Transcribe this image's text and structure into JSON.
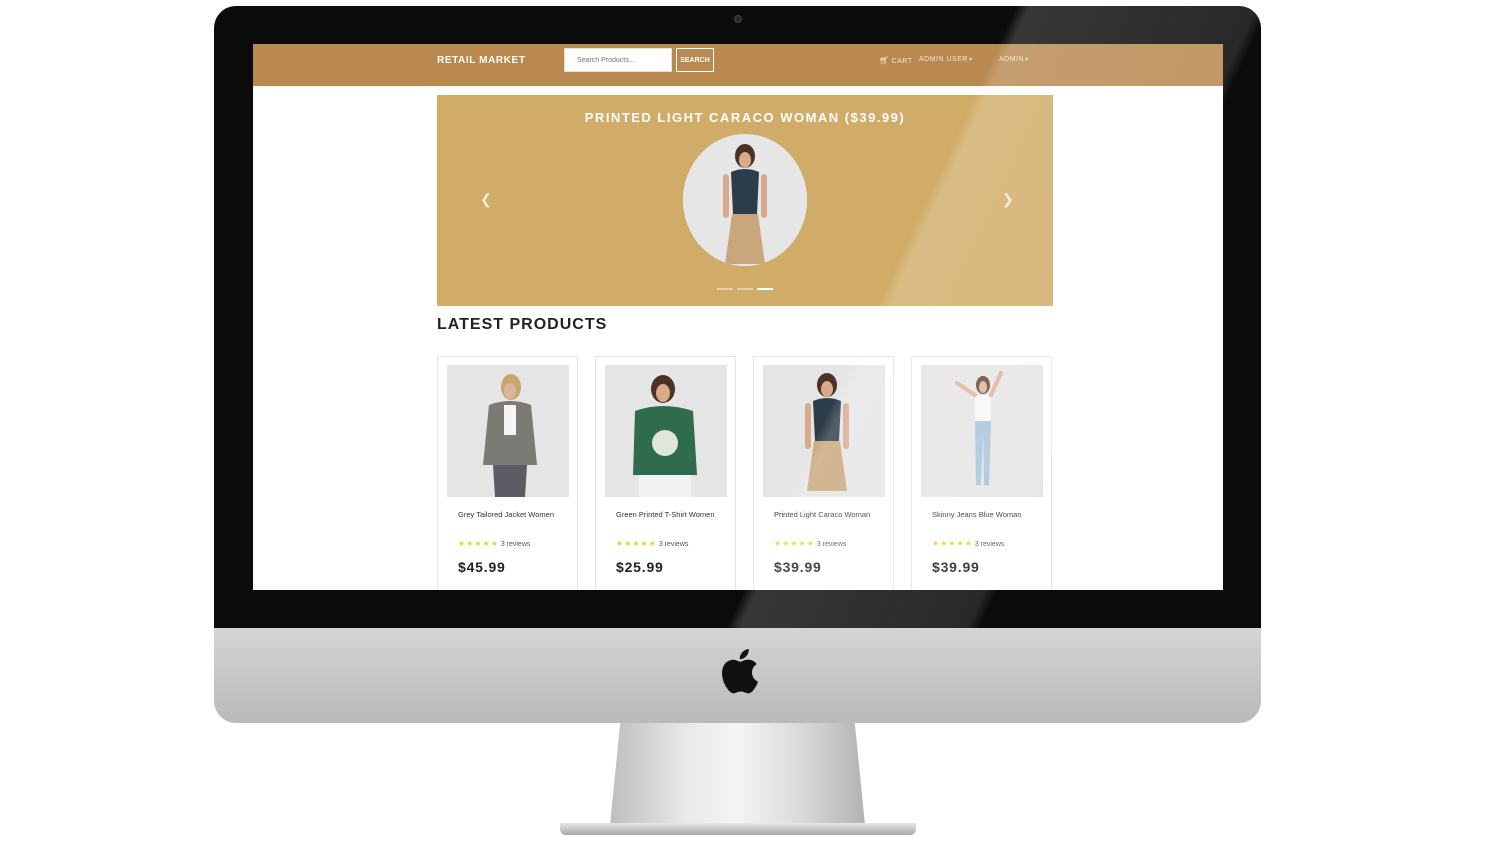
{
  "navbar": {
    "brand": "RETAIL MARKET",
    "search_placeholder": "Search Products...",
    "search_button": "SEARCH",
    "cart_label": "CART",
    "admin_user_label": "ADMIN USER",
    "admin_label": "ADMIN"
  },
  "banner": {
    "title": "PRINTED LIGHT CARACO WOMAN ($39.99)",
    "prev_icon": "chevron-left-icon",
    "next_icon": "chevron-right-icon",
    "slide_count": 3,
    "active_slide": 3
  },
  "latest": {
    "title": "LATEST PRODUCTS",
    "products": [
      {
        "name": "Grey Tailored Jacket Women",
        "rating": 5,
        "reviews": "3 reviews",
        "price": "$45.99"
      },
      {
        "name": "Green Printed T-Shirt Women",
        "rating": 5,
        "reviews": "3 reviews",
        "price": "$25.99"
      },
      {
        "name": "Printed Light Caraco Woman",
        "rating": 5,
        "reviews": "3 reviews",
        "price": "$39.99"
      },
      {
        "name": "Skinny Jeans Blue Woman",
        "rating": 5,
        "reviews": "3 reviews",
        "price": "$39.99"
      }
    ]
  },
  "colors": {
    "navbar": "#b9894f",
    "banner": "#d1ac68",
    "star": "#f0d21e"
  }
}
